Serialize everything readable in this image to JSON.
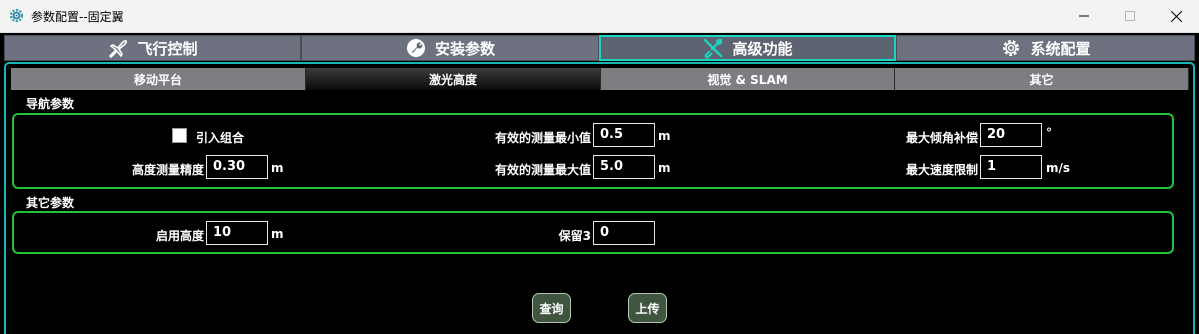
{
  "window": {
    "title": "参数配置--固定翼"
  },
  "main_tabs": [
    {
      "label": "飞行控制",
      "icon": "airplane-icon"
    },
    {
      "label": "安装参数",
      "icon": "wrench-icon"
    },
    {
      "label": "高级功能",
      "icon": "tools-icon",
      "active": true
    },
    {
      "label": "系统配置",
      "icon": "gear-icon"
    }
  ],
  "sub_tabs": [
    {
      "label": "移动平台"
    },
    {
      "label": "激光高度",
      "active": true
    },
    {
      "label": "视觉 & SLAM"
    },
    {
      "label": "其它"
    }
  ],
  "nav_group": {
    "title": "导航参数",
    "enable_combo_label": "引入组合",
    "enable_combo_checked": false,
    "height_precision_label": "高度测量精度",
    "height_precision_value": "0.30",
    "height_precision_unit": "m",
    "min_valid_label": "有效的测量最小值",
    "min_valid_value": "0.5",
    "min_valid_unit": "m",
    "max_valid_label": "有效的测量最大值",
    "max_valid_value": "5.0",
    "max_valid_unit": "m",
    "max_tilt_label": "最大倾角补偿",
    "max_tilt_value": "20",
    "max_tilt_unit": "°",
    "max_speed_label": "最大速度限制",
    "max_speed_value": "1",
    "max_speed_unit": "m/s"
  },
  "other_group": {
    "title": "其它参数",
    "enable_height_label": "启用高度",
    "enable_height_value": "10",
    "enable_height_unit": "m",
    "reserved3_label": "保留3",
    "reserved3_value": "0"
  },
  "actions": {
    "query_label": "查询",
    "upload_label": "上传"
  },
  "colors": {
    "tab_accent": "#19d5c2",
    "group_border": "#22c33a",
    "button_bg": "#3f5540"
  }
}
